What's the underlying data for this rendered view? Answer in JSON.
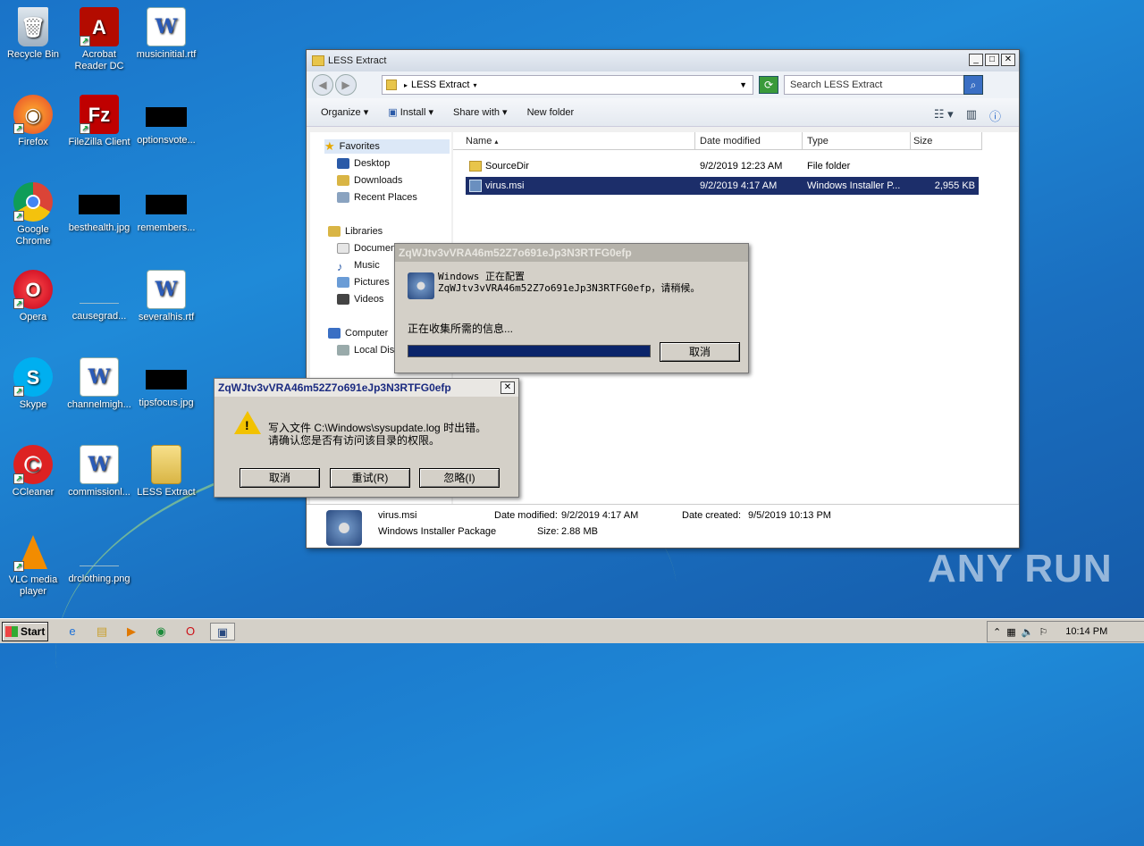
{
  "desktop": {
    "icons": [
      {
        "label": "Recycle Bin"
      },
      {
        "label": "Acrobat Reader DC"
      },
      {
        "label": "musicinitial.rtf"
      },
      {
        "label": "Firefox"
      },
      {
        "label": "FileZilla Client"
      },
      {
        "label": "optionsvote..."
      },
      {
        "label": "Google Chrome"
      },
      {
        "label": "besthealth.jpg"
      },
      {
        "label": "remembers..."
      },
      {
        "label": "Opera"
      },
      {
        "label": "causegrad..."
      },
      {
        "label": "severalhis.rtf"
      },
      {
        "label": "Skype"
      },
      {
        "label": "channelmigh..."
      },
      {
        "label": "tipsfocus.jpg"
      },
      {
        "label": "CCleaner"
      },
      {
        "label": "commissionl..."
      },
      {
        "label": "LESS Extract"
      },
      {
        "label": "VLC media player"
      },
      {
        "label": "drclothing.png"
      }
    ]
  },
  "explorer": {
    "title": "LESS Extract",
    "address": "LESS Extract",
    "search_placeholder": "Search LESS Extract",
    "toolbar": {
      "organize": "Organize",
      "install": "Install",
      "share": "Share with",
      "new_folder": "New folder"
    },
    "nav": {
      "favorites": "Favorites",
      "desktop": "Desktop",
      "downloads": "Downloads",
      "recent": "Recent Places",
      "libraries": "Libraries",
      "documents": "Documen",
      "music": "Music",
      "pictures": "Pictures",
      "videos": "Videos",
      "computer": "Computer",
      "local_disk": "Local Disk"
    },
    "columns": {
      "name": "Name",
      "date": "Date modified",
      "type": "Type",
      "size": "Size"
    },
    "files": [
      {
        "name": "SourceDir",
        "date": "9/2/2019 12:23 AM",
        "type": "File folder",
        "size": ""
      },
      {
        "name": "virus.msi",
        "date": "9/2/2019 4:17 AM",
        "type": "Windows Installer P...",
        "size": "2,955 KB"
      }
    ],
    "details": {
      "name": "virus.msi",
      "kind": "Windows Installer Package",
      "modified_label": "Date modified:",
      "modified": "9/2/2019 4:17 AM",
      "created_label": "Date created:",
      "created": "9/5/2019 10:13 PM",
      "size_label": "Size:",
      "size": "2.88 MB"
    }
  },
  "installer_dialog": {
    "title": "ZqWJtv3vVRA46m52Z7o691eJp3N3RTFG0efp",
    "message": "Windows 正在配置 ZqWJtv3vVRA46m52Z7o691eJp3N3RTFG0efp，请稍候。",
    "status": "正在收集所需的信息...",
    "progress": 1.0,
    "cancel": "取消"
  },
  "error_dialog": {
    "title": "ZqWJtv3vVRA46m52Z7o691eJp3N3RTFG0efp",
    "message_line1": "写入文件 C:\\Windows\\sysupdate.log 时出错。",
    "message_line2": "请确认您是否有访问该目录的权限。",
    "cancel": "取消",
    "retry": "重试(R)",
    "ignore": "忽略(I)"
  },
  "taskbar": {
    "start": "Start",
    "clock": "10:14 PM"
  },
  "watermark": "ANY RUN"
}
